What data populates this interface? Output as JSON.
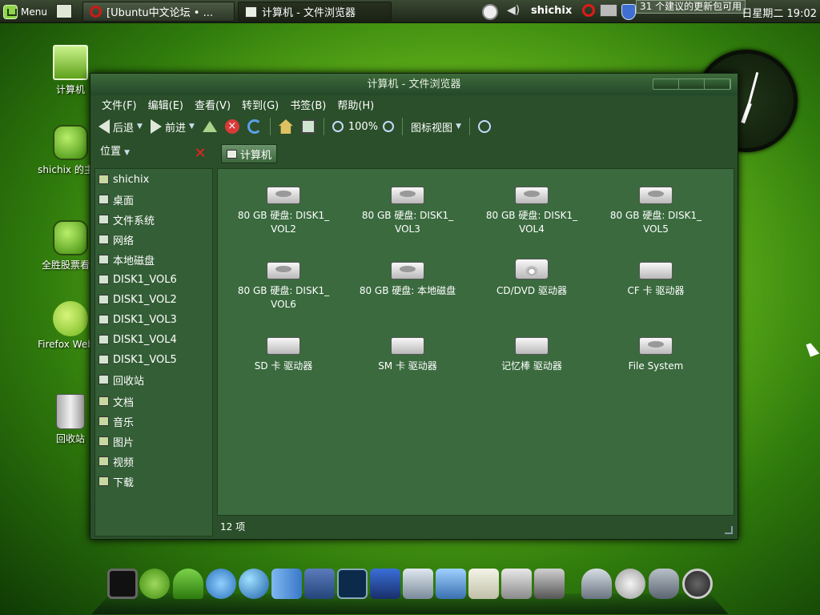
{
  "top_panel": {
    "menu_label": "Menu",
    "tasks": [
      {
        "label": "[Ubuntu中文论坛 • ...",
        "icon": "opera-icon"
      },
      {
        "label": "计算机 - 文件浏览器",
        "icon": "file-manager-icon"
      }
    ],
    "username": "shichix",
    "update_notice": "31 个建议的更新包可用",
    "datetime": "日星期二 19:02"
  },
  "desktop_icons": [
    {
      "label": "计算机",
      "icon": "computer-icon"
    },
    {
      "label": "shichix 的主文",
      "icon": "home-folder-icon"
    },
    {
      "label": "全胜股票看盘",
      "icon": "stock-app-icon"
    },
    {
      "label": "Firefox Web B",
      "icon": "firefox-icon"
    },
    {
      "label": "回收站",
      "icon": "trash-icon"
    }
  ],
  "window": {
    "title": "计算机 - 文件浏览器",
    "menu": [
      "文件(F)",
      "编辑(E)",
      "查看(V)",
      "转到(G)",
      "书签(B)",
      "帮助(H)"
    ],
    "toolbar": {
      "back": "后退",
      "forward": "前进",
      "zoom": "100%",
      "view_mode": "图标视图"
    },
    "sidebar_title": "位置",
    "pathbar": "计算机",
    "places": [
      {
        "label": "shichix",
        "icon": "home-icon"
      },
      {
        "label": "桌面",
        "icon": "desktop-icon"
      },
      {
        "label": "文件系统",
        "icon": "filesystem-icon"
      },
      {
        "label": "网络",
        "icon": "network-icon"
      },
      {
        "label": "本地磁盘",
        "icon": "drive-icon"
      },
      {
        "label": "DISK1_VOL6",
        "icon": "drive-icon"
      },
      {
        "label": "DISK1_VOL2",
        "icon": "drive-icon"
      },
      {
        "label": "DISK1_VOL3",
        "icon": "drive-icon"
      },
      {
        "label": "DISK1_VOL4",
        "icon": "drive-icon"
      },
      {
        "label": "DISK1_VOL5",
        "icon": "drive-icon"
      },
      {
        "label": "回收站",
        "icon": "trash-icon"
      },
      {
        "label": "文档",
        "icon": "folder-icon"
      },
      {
        "label": "音乐",
        "icon": "folder-icon"
      },
      {
        "label": "图片",
        "icon": "folder-icon"
      },
      {
        "label": "视频",
        "icon": "folder-icon"
      },
      {
        "label": "下载",
        "icon": "folder-icon"
      }
    ],
    "items": [
      {
        "line1": "80 GB 硬盘: DISK1_",
        "line2": "VOL2",
        "type": "disk"
      },
      {
        "line1": "80 GB 硬盘: DISK1_",
        "line2": "VOL3",
        "type": "disk"
      },
      {
        "line1": "80 GB 硬盘: DISK1_",
        "line2": "VOL4",
        "type": "disk"
      },
      {
        "line1": "80 GB 硬盘: DISK1_",
        "line2": "VOL5",
        "type": "disk"
      },
      {
        "line1": "80 GB 硬盘: DISK1_",
        "line2": "VOL6",
        "type": "disk"
      },
      {
        "line1": "80 GB 硬盘: 本地磁盘",
        "line2": "",
        "type": "disk"
      },
      {
        "line1": "CD/DVD 驱动器",
        "line2": "",
        "type": "cd"
      },
      {
        "line1": "CF 卡 驱动器",
        "line2": "",
        "type": "card"
      },
      {
        "line1": "SD 卡 驱动器",
        "line2": "",
        "type": "card"
      },
      {
        "line1": "SM 卡 驱动器",
        "line2": "",
        "type": "card"
      },
      {
        "line1": "记忆棒 驱动器",
        "line2": "",
        "type": "card"
      },
      {
        "line1": "File System",
        "line2": "",
        "type": "disk"
      }
    ],
    "status": "12 项"
  },
  "dock_icons": [
    "terminal-icon",
    "opensuse-icon",
    "worm-app-icon",
    "messenger-icon",
    "globe-icon",
    "finder-icon",
    "eagle-app-icon",
    "system-monitor-icon",
    "video-clapper-icon",
    "photos-icon",
    "picture-viewer-icon",
    "notes-icon",
    "mail-icon",
    "settings-icon",
    "alien-icon",
    "at-mail-icon",
    "elephant-icon",
    "power-icon"
  ],
  "colors": {
    "accent": "#3a6a3e",
    "panel": "#1d2618",
    "close_red": "#e22222"
  }
}
